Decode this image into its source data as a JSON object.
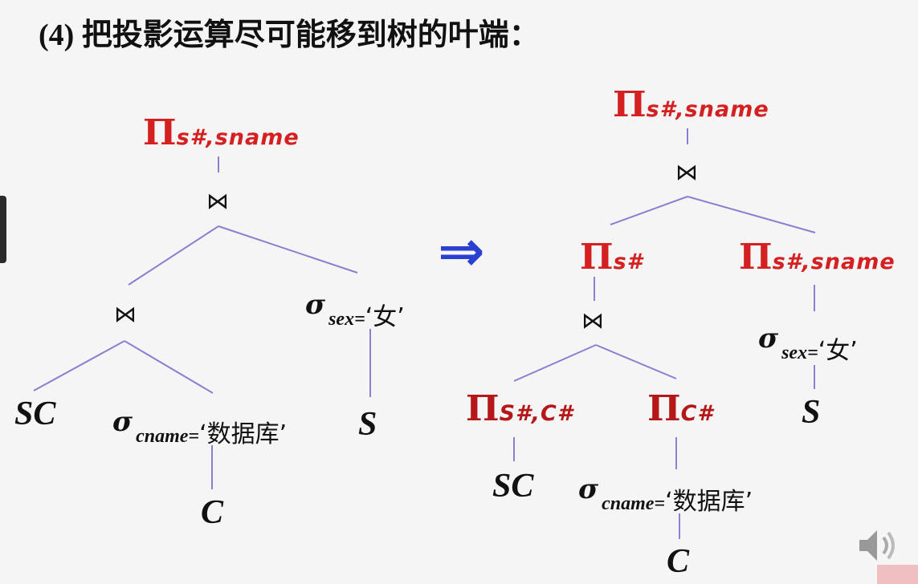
{
  "heading": "(4) 把投影运算尽可能移到树的叶端：",
  "operators": {
    "pi": "Π",
    "join": "⋈",
    "sigma": "σ",
    "implies": "⇒"
  },
  "left_tree": {
    "root_projection": "s#,sname",
    "leaf_sc": "SC",
    "select_cname": "cname=",
    "select_cname_value": "‘数据库’",
    "leaf_c": "C",
    "select_sex": "sex=",
    "select_sex_value": "‘女’",
    "leaf_s": "S"
  },
  "right_tree": {
    "root_projection": "s#,sname",
    "proj_s": "s#",
    "proj_s_sname": "s#,sname",
    "proj_s_c": "S#,C#",
    "proj_c": "C#",
    "leaf_sc": "SC",
    "select_cname": "cname=",
    "select_cname_value": "‘数据库’",
    "leaf_c": "C",
    "select_sex": "sex=",
    "select_sex_value": "‘女’",
    "leaf_s": "S"
  },
  "colors": {
    "projection": "#d42020",
    "edge": "#8a7fd0",
    "arrow": "#2b3fd0"
  }
}
